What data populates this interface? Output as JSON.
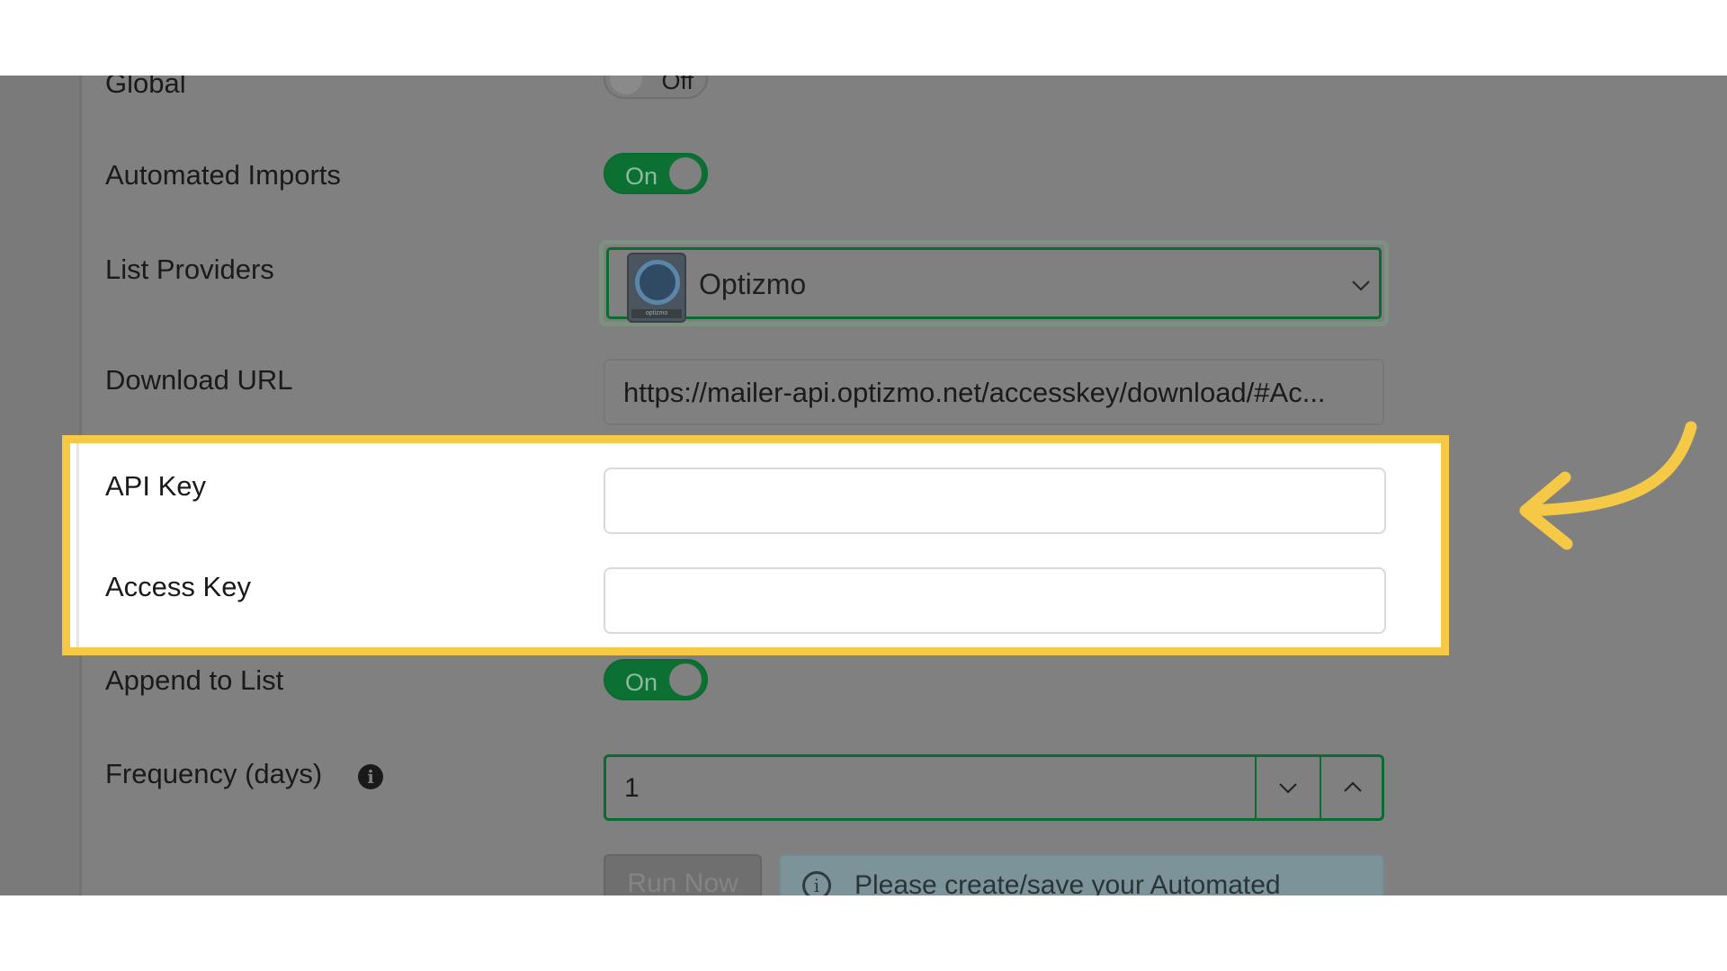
{
  "form": {
    "global": {
      "label": "Global",
      "toggle": "Off"
    },
    "automated_imports": {
      "label": "Automated Imports",
      "toggle": "On"
    },
    "list_providers": {
      "label": "List Providers",
      "selected": "Optizmo",
      "logo_text": "optizmo"
    },
    "download_url": {
      "label": "Download URL",
      "value": "https://mailer-api.optizmo.net/accesskey/download/#Ac..."
    },
    "api_key": {
      "label": "API Key",
      "value": ""
    },
    "access_key": {
      "label": "Access Key",
      "value": ""
    },
    "append_to_list": {
      "label": "Append to List",
      "toggle": "On"
    },
    "frequency": {
      "label": "Frequency (days)",
      "value": "1"
    },
    "run_now": {
      "label": "Run Now"
    },
    "alert": {
      "text": "Please create/save your Automated"
    }
  },
  "colors": {
    "highlight": "#f5c945",
    "toggle_on": "#0c7033",
    "overlay": "#808080"
  },
  "icons": {
    "frequency_info": "info-icon",
    "dropdown": "chevron-down-icon",
    "stepper_down": "chevron-down-icon",
    "stepper_up": "chevron-up-icon",
    "pointer": "curved-arrow-icon"
  }
}
